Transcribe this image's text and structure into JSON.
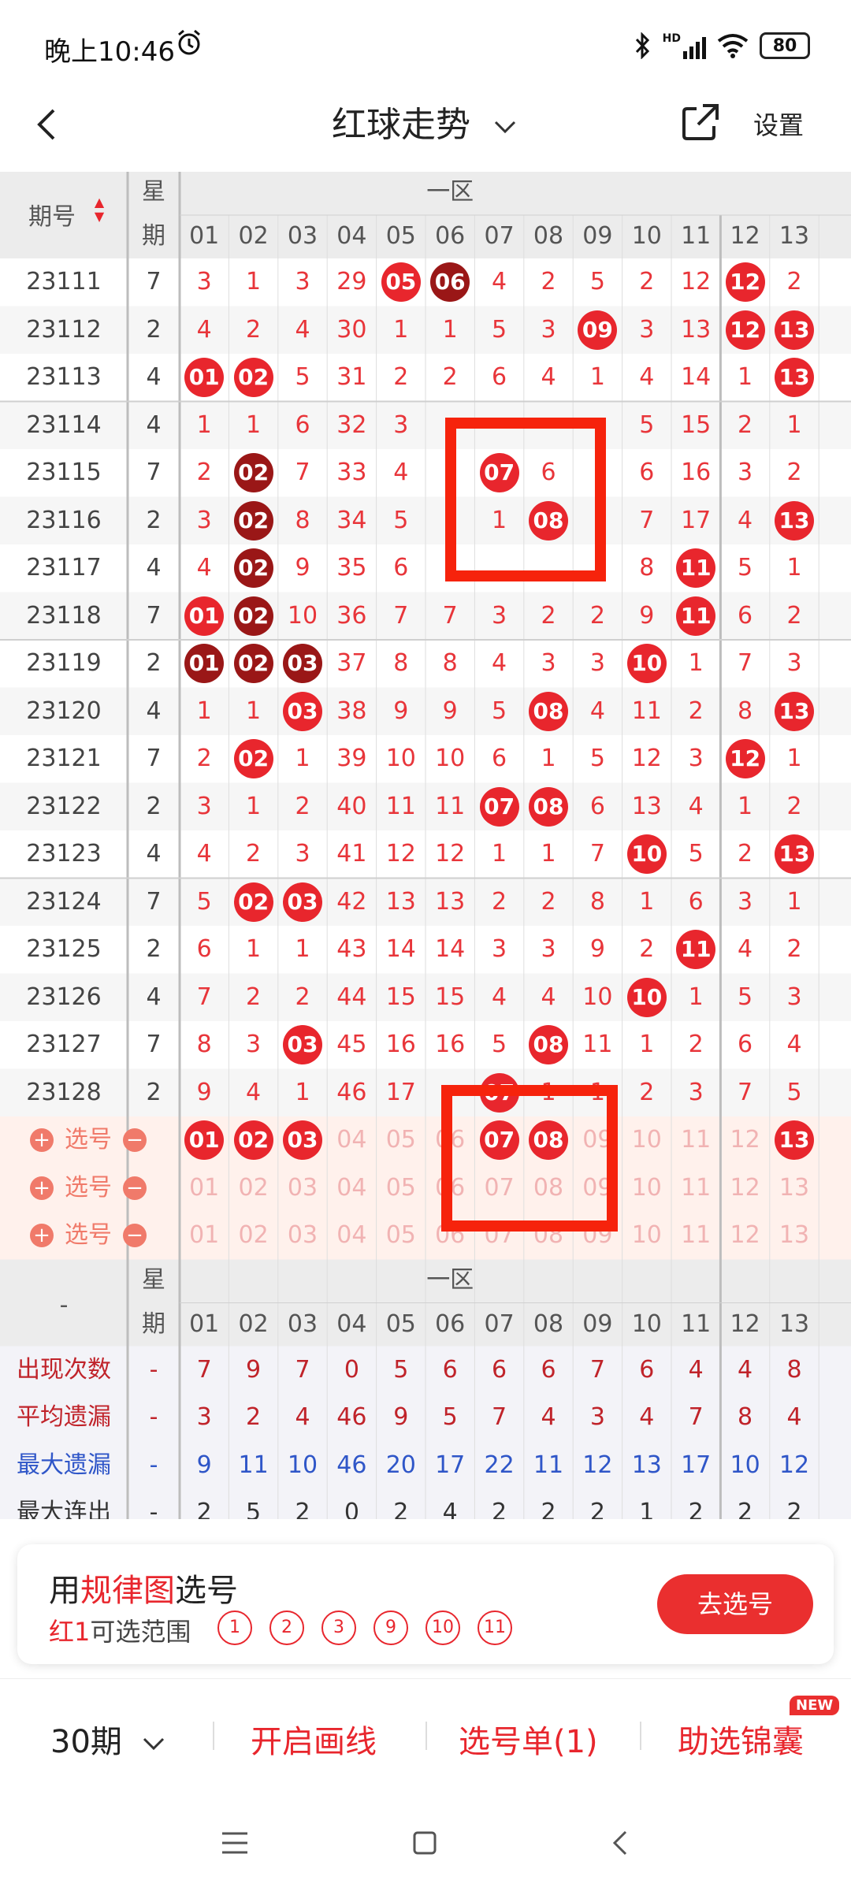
{
  "status_bar": {
    "time": "晚上10:46",
    "network": "HD",
    "battery": "80"
  },
  "header": {
    "title": "红球走势",
    "settings_label": "设置"
  },
  "table": {
    "col_issue": "期号",
    "col_week_top": "星",
    "col_week_bottom": "期",
    "zone_label": "一区",
    "numbers": [
      "01",
      "02",
      "03",
      "04",
      "05",
      "06",
      "07",
      "08",
      "09",
      "10",
      "11",
      "12",
      "13"
    ],
    "rows": [
      {
        "issue": "23111",
        "week": "7",
        "cells": [
          "3",
          "1",
          "3",
          "29",
          "05",
          "06",
          "4",
          "2",
          "5",
          "2",
          "12",
          "12",
          "2"
        ]
      },
      {
        "issue": "23112",
        "week": "2",
        "cells": [
          "4",
          "2",
          "4",
          "30",
          "1",
          "1",
          "5",
          "3",
          "09",
          "3",
          "13",
          "12",
          "13"
        ]
      },
      {
        "issue": "23113",
        "week": "4",
        "cells": [
          "01",
          "02",
          "5",
          "31",
          "2",
          "2",
          "6",
          "4",
          "1",
          "4",
          "14",
          "1",
          "13"
        ]
      },
      {
        "issue": "23114",
        "week": "4",
        "cells": [
          "1",
          "1",
          "6",
          "32",
          "3",
          "",
          "",
          "",
          "",
          "5",
          "15",
          "2",
          "1"
        ]
      },
      {
        "issue": "23115",
        "week": "7",
        "cells": [
          "2",
          "02",
          "7",
          "33",
          "4",
          "",
          "07",
          "6",
          "",
          "6",
          "16",
          "3",
          "2"
        ]
      },
      {
        "issue": "23116",
        "week": "2",
        "cells": [
          "3",
          "02",
          "8",
          "34",
          "5",
          "",
          "1",
          "08",
          "",
          "7",
          "17",
          "4",
          "13"
        ]
      },
      {
        "issue": "23117",
        "week": "4",
        "cells": [
          "4",
          "02",
          "9",
          "35",
          "6",
          "",
          "",
          "",
          "",
          "8",
          "11",
          "5",
          "1"
        ]
      },
      {
        "issue": "23118",
        "week": "7",
        "cells": [
          "01",
          "02",
          "10",
          "36",
          "7",
          "7",
          "3",
          "2",
          "2",
          "9",
          "11",
          "6",
          "2"
        ]
      },
      {
        "issue": "23119",
        "week": "2",
        "cells": [
          "01",
          "02",
          "03",
          "37",
          "8",
          "8",
          "4",
          "3",
          "3",
          "10",
          "1",
          "7",
          "3"
        ]
      },
      {
        "issue": "23120",
        "week": "4",
        "cells": [
          "1",
          "1",
          "03",
          "38",
          "9",
          "9",
          "5",
          "08",
          "4",
          "11",
          "2",
          "8",
          "13"
        ]
      },
      {
        "issue": "23121",
        "week": "7",
        "cells": [
          "2",
          "02",
          "1",
          "39",
          "10",
          "10",
          "6",
          "1",
          "5",
          "12",
          "3",
          "12",
          "1"
        ]
      },
      {
        "issue": "23122",
        "week": "2",
        "cells": [
          "3",
          "1",
          "2",
          "40",
          "11",
          "11",
          "07",
          "08",
          "6",
          "13",
          "4",
          "1",
          "2"
        ]
      },
      {
        "issue": "23123",
        "week": "4",
        "cells": [
          "4",
          "2",
          "3",
          "41",
          "12",
          "12",
          "1",
          "1",
          "7",
          "10",
          "5",
          "2",
          "13"
        ]
      },
      {
        "issue": "23124",
        "week": "7",
        "cells": [
          "5",
          "02",
          "03",
          "42",
          "13",
          "13",
          "2",
          "2",
          "8",
          "1",
          "6",
          "3",
          "1"
        ]
      },
      {
        "issue": "23125",
        "week": "2",
        "cells": [
          "6",
          "1",
          "1",
          "43",
          "14",
          "14",
          "3",
          "3",
          "9",
          "2",
          "11",
          "4",
          "2"
        ]
      },
      {
        "issue": "23126",
        "week": "4",
        "cells": [
          "7",
          "2",
          "2",
          "44",
          "15",
          "15",
          "4",
          "4",
          "10",
          "10",
          "1",
          "5",
          "3"
        ]
      },
      {
        "issue": "23127",
        "week": "7",
        "cells": [
          "8",
          "3",
          "03",
          "45",
          "16",
          "16",
          "5",
          "08",
          "11",
          "1",
          "2",
          "6",
          "4"
        ]
      },
      {
        "issue": "23128",
        "week": "2",
        "cells": [
          "9",
          "4",
          "1",
          "46",
          "17",
          "",
          "07",
          "1",
          "1",
          "2",
          "3",
          "7",
          "5"
        ]
      }
    ],
    "pick_rows": [
      {
        "label": "选号",
        "cells": [
          "01",
          "02",
          "03",
          "04",
          "05",
          "06",
          "07",
          "08",
          "09",
          "10",
          "11",
          "12",
          "13"
        ]
      },
      {
        "label": "选号",
        "cells": [
          "01",
          "02",
          "03",
          "04",
          "05",
          "06",
          "07",
          "08",
          "09",
          "10",
          "11",
          "12",
          "13"
        ]
      },
      {
        "label": "选号",
        "cells": [
          "01",
          "02",
          "03",
          "04",
          "05",
          "06",
          "07",
          "08",
          "09",
          "10",
          "11",
          "12",
          "13"
        ]
      }
    ],
    "stats_dash": "-",
    "stats": [
      {
        "label": "出现次数",
        "week": "-",
        "cells": [
          "7",
          "9",
          "7",
          "0",
          "5",
          "6",
          "6",
          "6",
          "7",
          "6",
          "4",
          "4",
          "8"
        ]
      },
      {
        "label": "平均遗漏",
        "week": "-",
        "cells": [
          "3",
          "2",
          "4",
          "46",
          "9",
          "5",
          "7",
          "4",
          "3",
          "4",
          "7",
          "8",
          "4"
        ]
      },
      {
        "label": "最大遗漏",
        "week": "-",
        "cells": [
          "9",
          "11",
          "10",
          "46",
          "20",
          "17",
          "22",
          "11",
          "12",
          "13",
          "17",
          "10",
          "12"
        ]
      },
      {
        "label": "最大连出",
        "week": "-",
        "cells": [
          "2",
          "5",
          "2",
          "0",
          "2",
          "4",
          "2",
          "2",
          "2",
          "1",
          "2",
          "2",
          "2"
        ]
      }
    ]
  },
  "rule_card": {
    "prefix": "用",
    "highlight": "规律图",
    "suffix": "选号",
    "sub_red": "红1",
    "sub_text": "可选范围",
    "range": [
      "1",
      "2",
      "3",
      "9",
      "10",
      "11"
    ],
    "button": "去选号"
  },
  "toolbar": {
    "periods": "30期",
    "draw_line": "开启画线",
    "pick_list": "选号单(1)",
    "helper": "助选锦囊",
    "new_badge": "NEW"
  },
  "colors": {
    "red": "#e8262d",
    "dark_red": "#9a1717",
    "blue": "#2f56c8",
    "marker": "#f6230c"
  }
}
